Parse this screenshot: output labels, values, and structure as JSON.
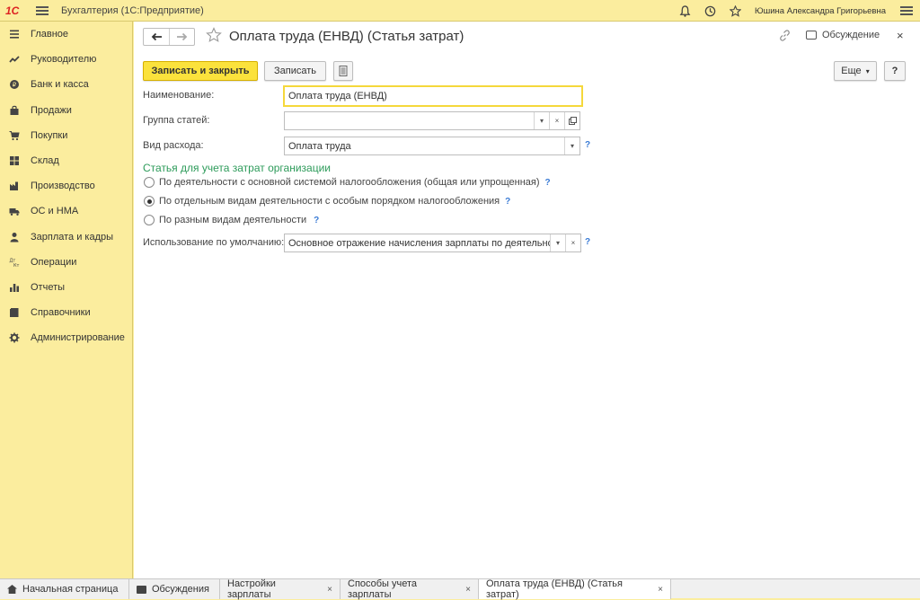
{
  "app": {
    "logo": "1С",
    "title": "Бухгалтерия  (1С:Предприятие)",
    "user_name": "Юшина Александра Григорьевна"
  },
  "sidebar": {
    "items": [
      {
        "label": "Главное",
        "icon": "list-icon"
      },
      {
        "label": "Руководителю",
        "icon": "trend-icon"
      },
      {
        "label": "Банк и касса",
        "icon": "coin-icon"
      },
      {
        "label": "Продажи",
        "icon": "bag-icon"
      },
      {
        "label": "Покупки",
        "icon": "cart-icon"
      },
      {
        "label": "Склад",
        "icon": "grid-icon"
      },
      {
        "label": "Производство",
        "icon": "factory-icon"
      },
      {
        "label": "ОС и НМА",
        "icon": "truck-icon"
      },
      {
        "label": "Зарплата и кадры",
        "icon": "person-icon"
      },
      {
        "label": "Операции",
        "icon": "dtkt-icon"
      },
      {
        "label": "Отчеты",
        "icon": "bars-icon"
      },
      {
        "label": "Справочники",
        "icon": "book-icon"
      },
      {
        "label": "Администрирование",
        "icon": "gear-icon"
      }
    ]
  },
  "form": {
    "title": "Оплата труда (ЕНВД) (Статья затрат)",
    "discuss_label": "Обсуждение",
    "save_close_label": "Записать и закрыть",
    "save_label": "Записать",
    "more_label": "Еще",
    "more_arrow": "▾",
    "help_label": "?",
    "name_label": "Наименование:",
    "name_value": "Оплата труда (ЕНВД)",
    "group_label": "Группа статей:",
    "group_value": "",
    "expense_label": "Вид расхода:",
    "expense_value": "Оплата труда",
    "section_title": "Статья для учета затрат организации",
    "radio_options": [
      {
        "label": "По деятельности с основной системой налогообложения (общая или упрощенная)",
        "selected": false
      },
      {
        "label": "По отдельным видам деятельности с особым порядком налогообложения",
        "selected": true
      },
      {
        "label": "По разным видам деятельности",
        "selected": false
      }
    ],
    "default_use_label": "Использование по умолчанию:",
    "default_use_value": "Основное отражение начисления зарплаты по деятельности",
    "q": "?"
  },
  "tabs": [
    {
      "label": "Начальная страница",
      "closable": false,
      "active": false
    },
    {
      "label": "Обсуждения",
      "closable": false,
      "active": false
    },
    {
      "label": "Настройки зарплаты",
      "closable": true,
      "active": false
    },
    {
      "label": "Способы учета зарплаты",
      "closable": true,
      "active": false
    },
    {
      "label": "Оплата труда (ЕНВД) (Статья затрат)",
      "closable": true,
      "active": true
    }
  ],
  "glyphs": {
    "close": "×",
    "drop": "▾",
    "back": "🡐",
    "fwd": "🡒"
  }
}
